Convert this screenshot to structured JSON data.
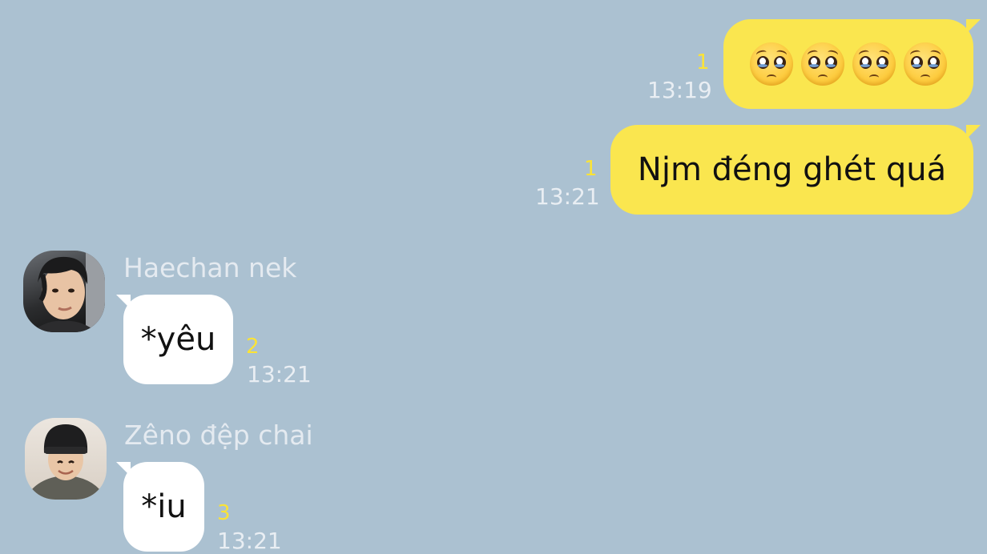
{
  "messages": [
    {
      "direction": "outgoing",
      "text": "🥺🥺🥺🥺",
      "emoji_icons": [
        "pleading-face-icon",
        "pleading-face-icon",
        "pleading-face-icon",
        "pleading-face-icon"
      ],
      "unread": "1",
      "time": "13:19"
    },
    {
      "direction": "outgoing",
      "text": "Njm đéng ghét quá",
      "unread": "1",
      "time": "13:21"
    },
    {
      "direction": "incoming",
      "sender": "Haechan nek",
      "text": "*yêu",
      "unread": "2",
      "time": "13:21"
    },
    {
      "direction": "incoming",
      "sender": "Zêno đệp chai",
      "text": "*iu",
      "unread": "3",
      "time": "13:21"
    }
  ],
  "colors": {
    "background": "#abc1d1",
    "outgoing_bubble": "#fae64f",
    "incoming_bubble": "#ffffff",
    "unread_count": "#fbe336",
    "timestamp": "#e9eef3"
  }
}
